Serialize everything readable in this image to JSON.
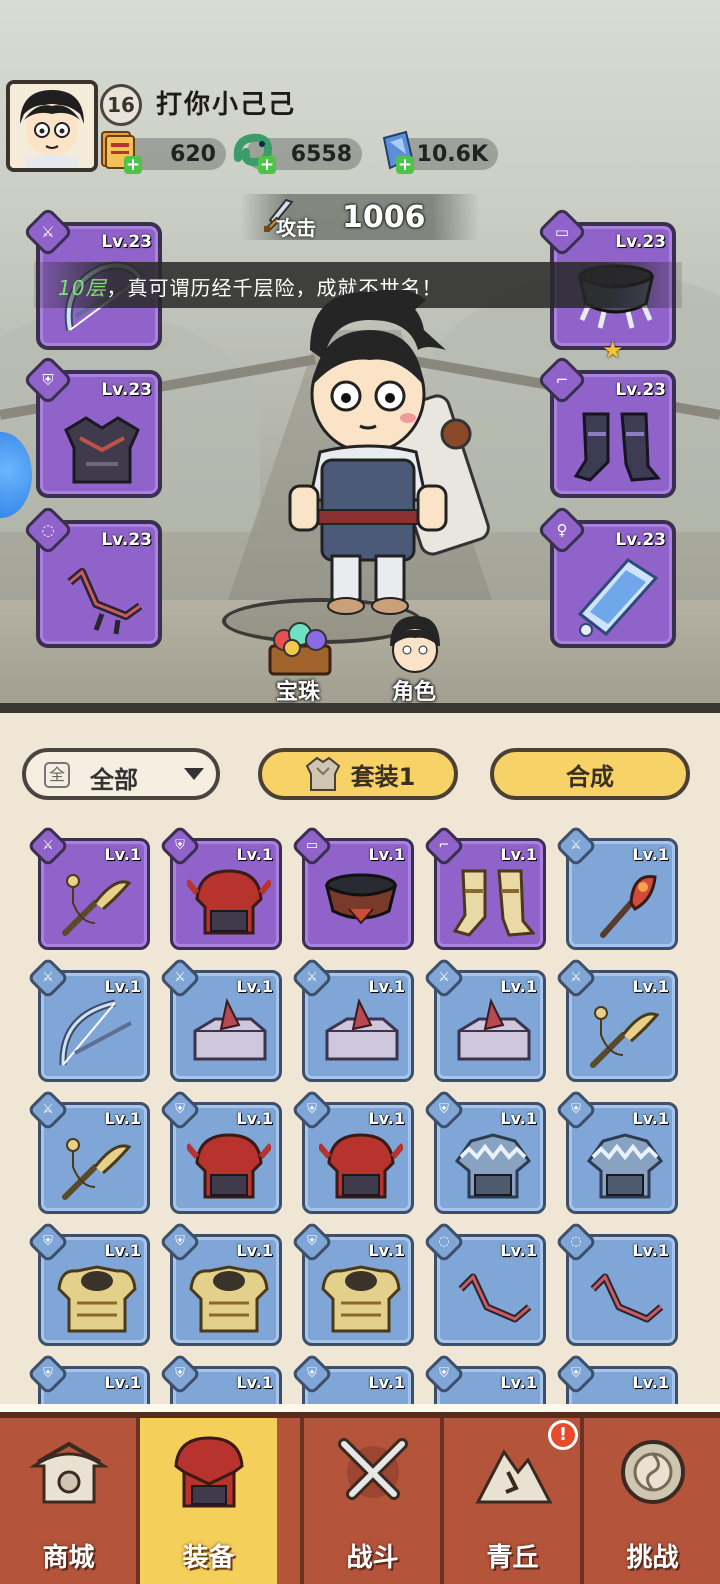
{
  "player": {
    "level": "16",
    "name": "打你小己己"
  },
  "resources": [
    {
      "icon": "ticket-stack-icon",
      "value": "620"
    },
    {
      "icon": "jade-dragon-icon",
      "value": "6558"
    },
    {
      "icon": "crystal-icon",
      "value": "10.6K"
    }
  ],
  "attack": {
    "label": "攻击",
    "value": "1006"
  },
  "banner": {
    "floor": "10层",
    "text": "，真可谓历经千层险，成就不世名！"
  },
  "equipped": {
    "left": [
      {
        "slot": "weapon",
        "level": "Lv.23",
        "rarity": "purple"
      },
      {
        "slot": "armor",
        "level": "Lv.23",
        "rarity": "purple"
      },
      {
        "slot": "necklace",
        "level": "Lv.23",
        "rarity": "purple"
      }
    ],
    "right": [
      {
        "slot": "belt",
        "level": "Lv.23",
        "rarity": "purple",
        "star": "★"
      },
      {
        "slot": "boots",
        "level": "Lv.23",
        "rarity": "purple"
      },
      {
        "slot": "ring",
        "level": "Lv.23",
        "rarity": "purple"
      }
    ]
  },
  "scene_buttons": {
    "gems": "宝珠",
    "character": "角色"
  },
  "filter": {
    "icon_text": "全",
    "label": "全部"
  },
  "actions": {
    "set": "套装1",
    "synth": "合成"
  },
  "inventory": [
    {
      "level": "Lv.1",
      "rarity": "purple",
      "item": "staff"
    },
    {
      "level": "Lv.1",
      "rarity": "purple",
      "item": "helmet-red"
    },
    {
      "level": "Lv.1",
      "rarity": "purple",
      "item": "belt-red"
    },
    {
      "level": "Lv.1",
      "rarity": "purple",
      "item": "boots-gold"
    },
    {
      "level": "Lv.1",
      "rarity": "blue",
      "item": "staff-red"
    },
    {
      "level": "Lv.1",
      "rarity": "blue",
      "item": "bow"
    },
    {
      "level": "Lv.1",
      "rarity": "blue",
      "item": "armor-box"
    },
    {
      "level": "Lv.1",
      "rarity": "blue",
      "item": "armor-box"
    },
    {
      "level": "Lv.1",
      "rarity": "blue",
      "item": "armor-box"
    },
    {
      "level": "Lv.1",
      "rarity": "blue",
      "item": "staff"
    },
    {
      "level": "Lv.1",
      "rarity": "blue",
      "item": "staff"
    },
    {
      "level": "Lv.1",
      "rarity": "blue",
      "item": "helmet-red"
    },
    {
      "level": "Lv.1",
      "rarity": "blue",
      "item": "helmet-red"
    },
    {
      "level": "Lv.1",
      "rarity": "blue",
      "item": "helmet-ice"
    },
    {
      "level": "Lv.1",
      "rarity": "blue",
      "item": "helmet-ice"
    },
    {
      "level": "Lv.1",
      "rarity": "blue",
      "item": "armor-gold"
    },
    {
      "level": "Lv.1",
      "rarity": "blue",
      "item": "armor-gold"
    },
    {
      "level": "Lv.1",
      "rarity": "blue",
      "item": "armor-gold"
    },
    {
      "level": "Lv.1",
      "rarity": "blue",
      "item": "necklace"
    },
    {
      "level": "Lv.1",
      "rarity": "blue",
      "item": "necklace"
    },
    {
      "level": "Lv.1",
      "rarity": "blue",
      "item": "partial"
    },
    {
      "level": "Lv.1",
      "rarity": "blue",
      "item": "partial"
    },
    {
      "level": "Lv.1",
      "rarity": "blue",
      "item": "partial"
    },
    {
      "level": "Lv.1",
      "rarity": "blue",
      "item": "partial"
    },
    {
      "level": "Lv.1",
      "rarity": "blue",
      "item": "partial"
    }
  ],
  "nav": [
    {
      "label": "商城",
      "icon": "shop-pagoda-icon"
    },
    {
      "label": "装备",
      "icon": "equipment-helmet-icon",
      "active": true
    },
    {
      "label": "战斗",
      "icon": "crossed-swords-icon"
    },
    {
      "label": "青丘",
      "icon": "mountain-icon",
      "alert": "!"
    },
    {
      "label": "挑战",
      "icon": "challenge-drum-icon"
    }
  ],
  "colors": {
    "purple": "#8f63c9",
    "blue": "#7fa6d6",
    "nav": "#b4543a",
    "nav_active": "#f4cf5a",
    "button": "#f7d266"
  }
}
